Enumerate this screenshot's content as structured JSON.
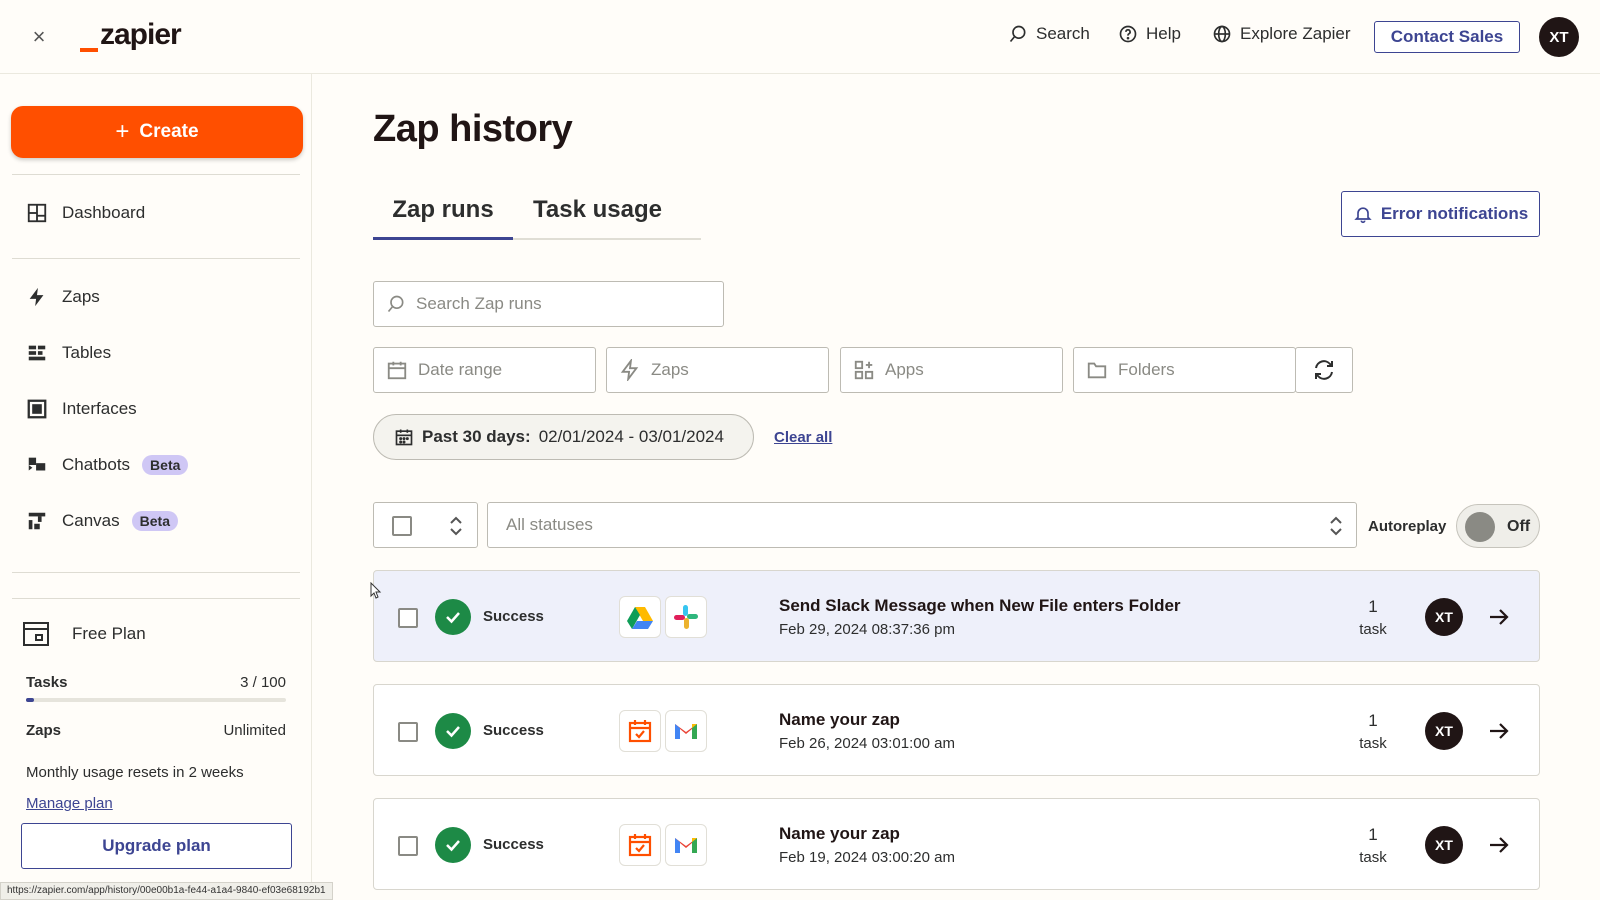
{
  "header": {
    "close": "×",
    "logo": "zapier",
    "search": "Search",
    "help": "Help",
    "explore": "Explore Zapier",
    "contact_sales": "Contact Sales",
    "avatar": "XT"
  },
  "sidebar": {
    "create_label": "Create",
    "items": [
      {
        "label": "Dashboard"
      },
      {
        "label": "Zaps"
      },
      {
        "label": "Tables"
      },
      {
        "label": "Interfaces"
      },
      {
        "label": "Chatbots",
        "badge": "Beta"
      },
      {
        "label": "Canvas",
        "badge": "Beta"
      }
    ],
    "plan": {
      "title": "Free Plan",
      "tasks_label": "Tasks",
      "tasks_value": "3 / 100",
      "tasks_used": 3,
      "tasks_limit": 100,
      "zaps_label": "Zaps",
      "zaps_value": "Unlimited",
      "reset_text": "Monthly usage resets in 2 weeks",
      "manage_link": "Manage plan",
      "upgrade_button": "Upgrade plan"
    },
    "status_url": "https://zapier.com/app/history/00e00b1a-fe44-a1a4-9840-ef03e68192b1"
  },
  "main": {
    "title": "Zap history",
    "tabs": [
      {
        "label": "Zap runs",
        "active": true
      },
      {
        "label": "Task usage",
        "active": false
      }
    ],
    "error_notifications": "Error notifications",
    "search_placeholder": "Search Zap runs",
    "filters": {
      "date_range": "Date range",
      "zaps": "Zaps",
      "apps": "Apps",
      "folders": "Folders"
    },
    "date_chip": {
      "label": "Past 30 days:",
      "value": "02/01/2024 - 03/01/2024"
    },
    "clear_all": "Clear all",
    "status_select": "All statuses",
    "autoplay_label": "Autoreplay",
    "autoplay_state": "Off",
    "runs": [
      {
        "status": "Success",
        "apps": [
          "google-drive-icon",
          "slack-icon"
        ],
        "name": "Send Slack Message when New File enters Folder",
        "time": "Feb 29, 2024 08:37:36 pm",
        "tasks": "1",
        "task_label": "task",
        "avatar": "XT"
      },
      {
        "status": "Success",
        "apps": [
          "schedule-icon",
          "gmail-icon"
        ],
        "name": "Name your zap",
        "time": "Feb 26, 2024 03:01:00 am",
        "tasks": "1",
        "task_label": "task",
        "avatar": "XT"
      },
      {
        "status": "Success",
        "apps": [
          "schedule-icon",
          "gmail-icon"
        ],
        "name": "Name your zap",
        "time": "Feb 19, 2024 03:00:20 am",
        "tasks": "1",
        "task_label": "task",
        "avatar": "XT"
      }
    ]
  },
  "colors": {
    "brand_orange": "#ff4f00",
    "accent_blue": "#3d4592",
    "success_green": "#1d8a46",
    "beta_purple": "#cfc7f5"
  }
}
